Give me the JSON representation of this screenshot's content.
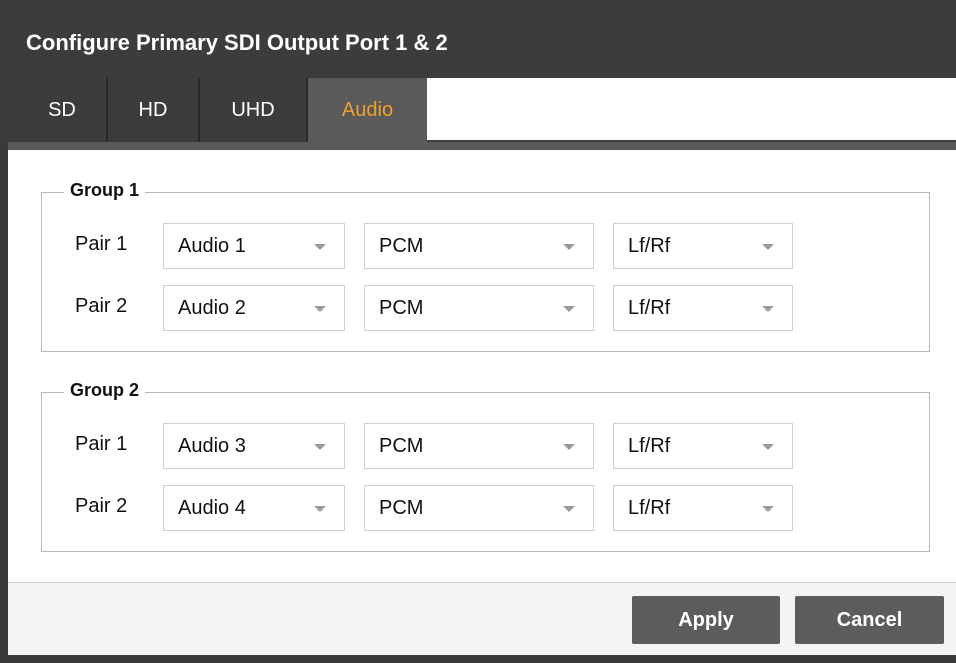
{
  "dialog": {
    "title": "Configure Primary SDI Output Port 1 & 2"
  },
  "tabs": [
    {
      "label": "SD",
      "active": false
    },
    {
      "label": "HD",
      "active": false
    },
    {
      "label": "UHD",
      "active": false
    },
    {
      "label": "Audio",
      "active": true
    }
  ],
  "groups": [
    {
      "legend": "Group 1",
      "pairs": [
        {
          "label": "Pair 1",
          "source": "Audio 1",
          "format": "PCM",
          "channels": "Lf/Rf"
        },
        {
          "label": "Pair 2",
          "source": "Audio 2",
          "format": "PCM",
          "channels": "Lf/Rf"
        }
      ]
    },
    {
      "legend": "Group 2",
      "pairs": [
        {
          "label": "Pair 1",
          "source": "Audio 3",
          "format": "PCM",
          "channels": "Lf/Rf"
        },
        {
          "label": "Pair 2",
          "source": "Audio 4",
          "format": "PCM",
          "channels": "Lf/Rf"
        }
      ]
    }
  ],
  "footer": {
    "apply_label": "Apply",
    "cancel_label": "Cancel"
  },
  "colors": {
    "active_tab_text": "#f0a030",
    "header_bg": "#3c3c3c",
    "button_bg": "#5c5c5c"
  }
}
